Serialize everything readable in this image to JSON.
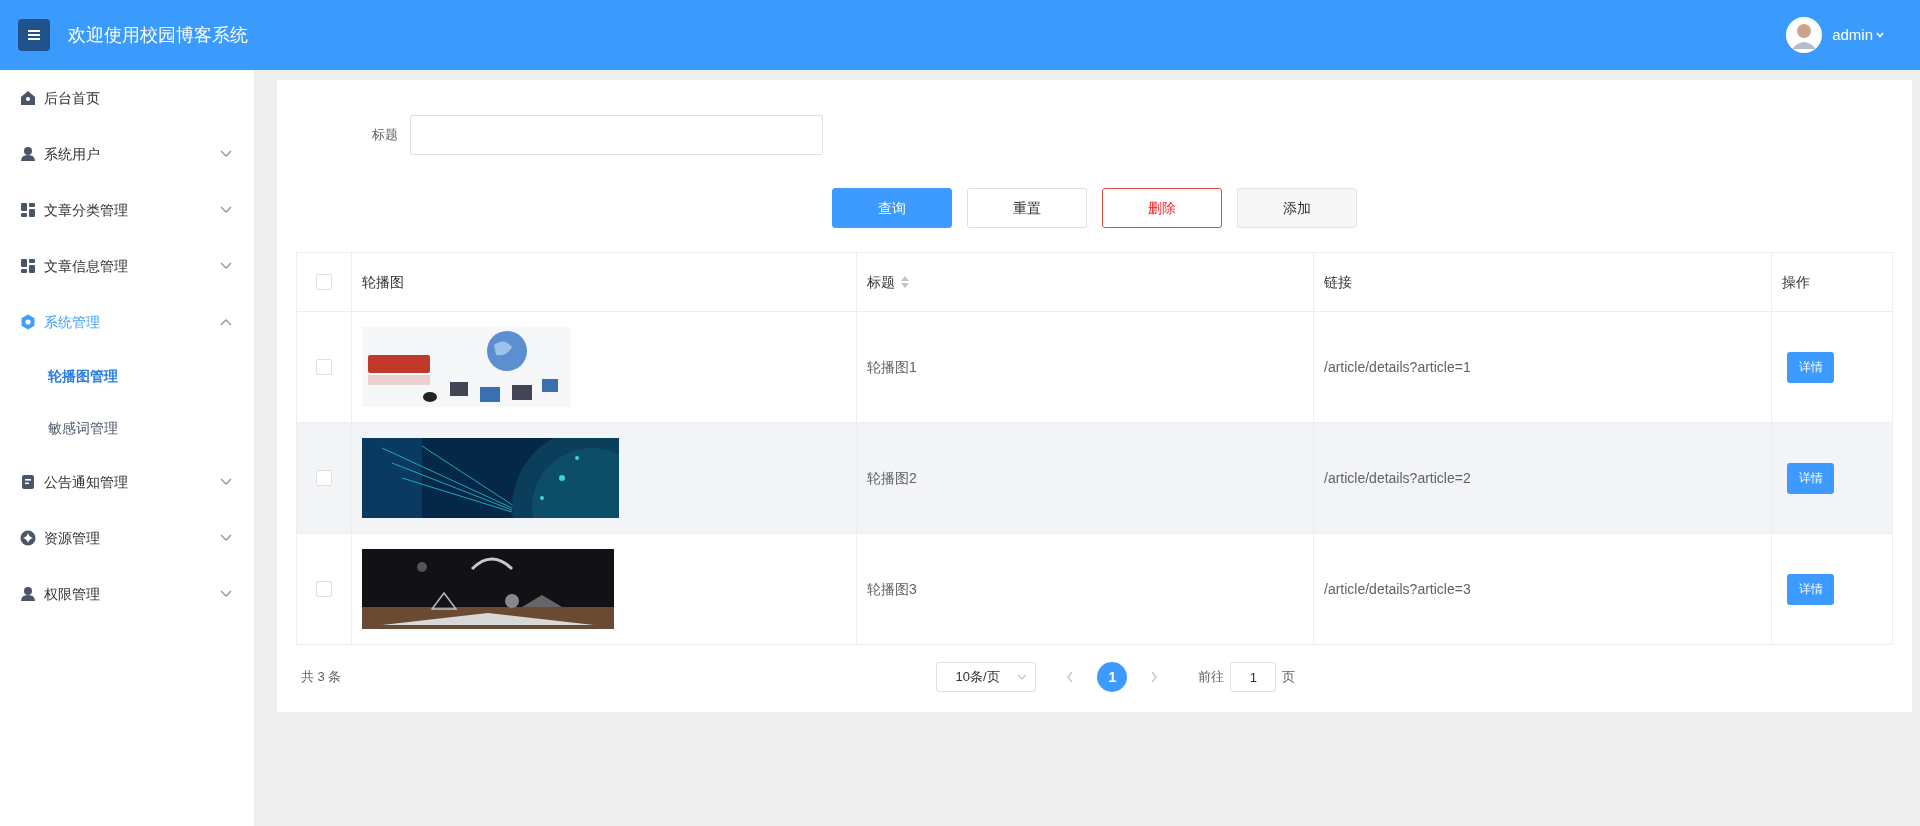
{
  "header": {
    "title": "欢迎使用校园博客系统",
    "user": "admin"
  },
  "sidebar": {
    "items": [
      {
        "label": "后台首页",
        "kind": "link",
        "selected": false
      },
      {
        "label": "系统用户",
        "kind": "group",
        "expanded": false,
        "selected": false
      },
      {
        "label": "文章分类管理",
        "kind": "group",
        "expanded": false,
        "selected": false
      },
      {
        "label": "文章信息管理",
        "kind": "group",
        "expanded": false,
        "selected": false
      },
      {
        "label": "系统管理",
        "kind": "group",
        "expanded": true,
        "selected": true,
        "children": [
          {
            "label": "轮播图管理",
            "selected": true
          },
          {
            "label": "敏感词管理",
            "selected": false
          }
        ]
      },
      {
        "label": "公告通知管理",
        "kind": "group",
        "expanded": false,
        "selected": false
      },
      {
        "label": "资源管理",
        "kind": "group",
        "expanded": false,
        "selected": false
      },
      {
        "label": "权限管理",
        "kind": "group",
        "expanded": false,
        "selected": false
      }
    ]
  },
  "filter": {
    "label": "标题",
    "buttons": [
      {
        "label": "查询",
        "kind": "primary"
      },
      {
        "label": "重置",
        "kind": "default"
      },
      {
        "label": "删除",
        "kind": "danger"
      },
      {
        "label": "添加",
        "kind": "hover"
      }
    ]
  },
  "table": {
    "all_checked": false,
    "columns": [
      {
        "label": "轮播图",
        "sortable": false
      },
      {
        "label": "标题",
        "sortable": true
      },
      {
        "label": "链接",
        "sortable": false
      },
      {
        "label": "操作",
        "sortable": false
      }
    ],
    "rows": [
      {
        "checked": false,
        "highlighted": false,
        "title": "轮播图1",
        "link": "/article/details?article=1",
        "action": "详情"
      },
      {
        "checked": false,
        "highlighted": true,
        "title": "轮播图2",
        "link": "/article/details?article=2",
        "action": "详情"
      },
      {
        "checked": false,
        "highlighted": false,
        "title": "轮播图3",
        "link": "/article/details?article=3",
        "action": "详情"
      }
    ]
  },
  "pagination": {
    "total": "共 3 条",
    "page_size": "10条/页",
    "pages": [
      {
        "label": "1",
        "selected": true
      }
    ],
    "goto_label": "前往",
    "goto_value": "1",
    "goto_suffix": "页"
  }
}
